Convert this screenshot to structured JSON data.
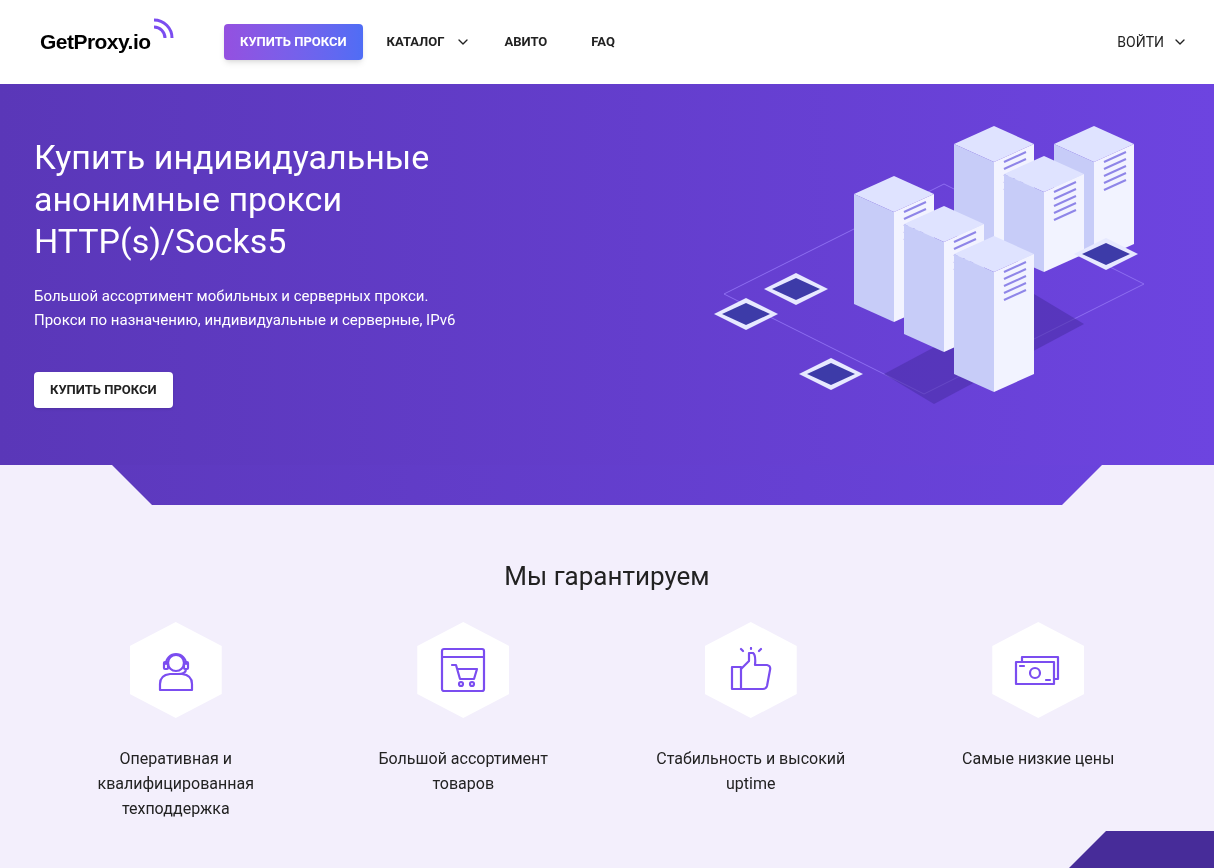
{
  "header": {
    "logo": "GetProxy.io",
    "nav": [
      {
        "kind": "button",
        "label": "КУПИТЬ ПРОКСИ"
      },
      {
        "kind": "dropdown",
        "label": "КАТАЛОГ"
      },
      {
        "kind": "link",
        "label": "АВИТО"
      },
      {
        "kind": "link",
        "label": "FAQ"
      }
    ],
    "login": "ВОЙТИ"
  },
  "hero": {
    "title": "Купить индивидуальные анонимные прокси HTTP(s)/Socks5",
    "lines": [
      "Большой ассортимент мобильных и серверных прокси.",
      "Прокси по назначению, индивидуальные и серверные, IPv6"
    ],
    "button": "КУПИТЬ ПРОКСИ"
  },
  "guarantees": {
    "title": "Мы гарантируем",
    "items": [
      {
        "kind": "support",
        "label": "Оперативная и квалифицированная техподдержка"
      },
      {
        "kind": "shop",
        "label": "Большой ассортимент товаров"
      },
      {
        "kind": "like",
        "label": "Стабильность и высокий uptime"
      },
      {
        "kind": "money",
        "label": "Самые низкие цены"
      }
    ]
  }
}
